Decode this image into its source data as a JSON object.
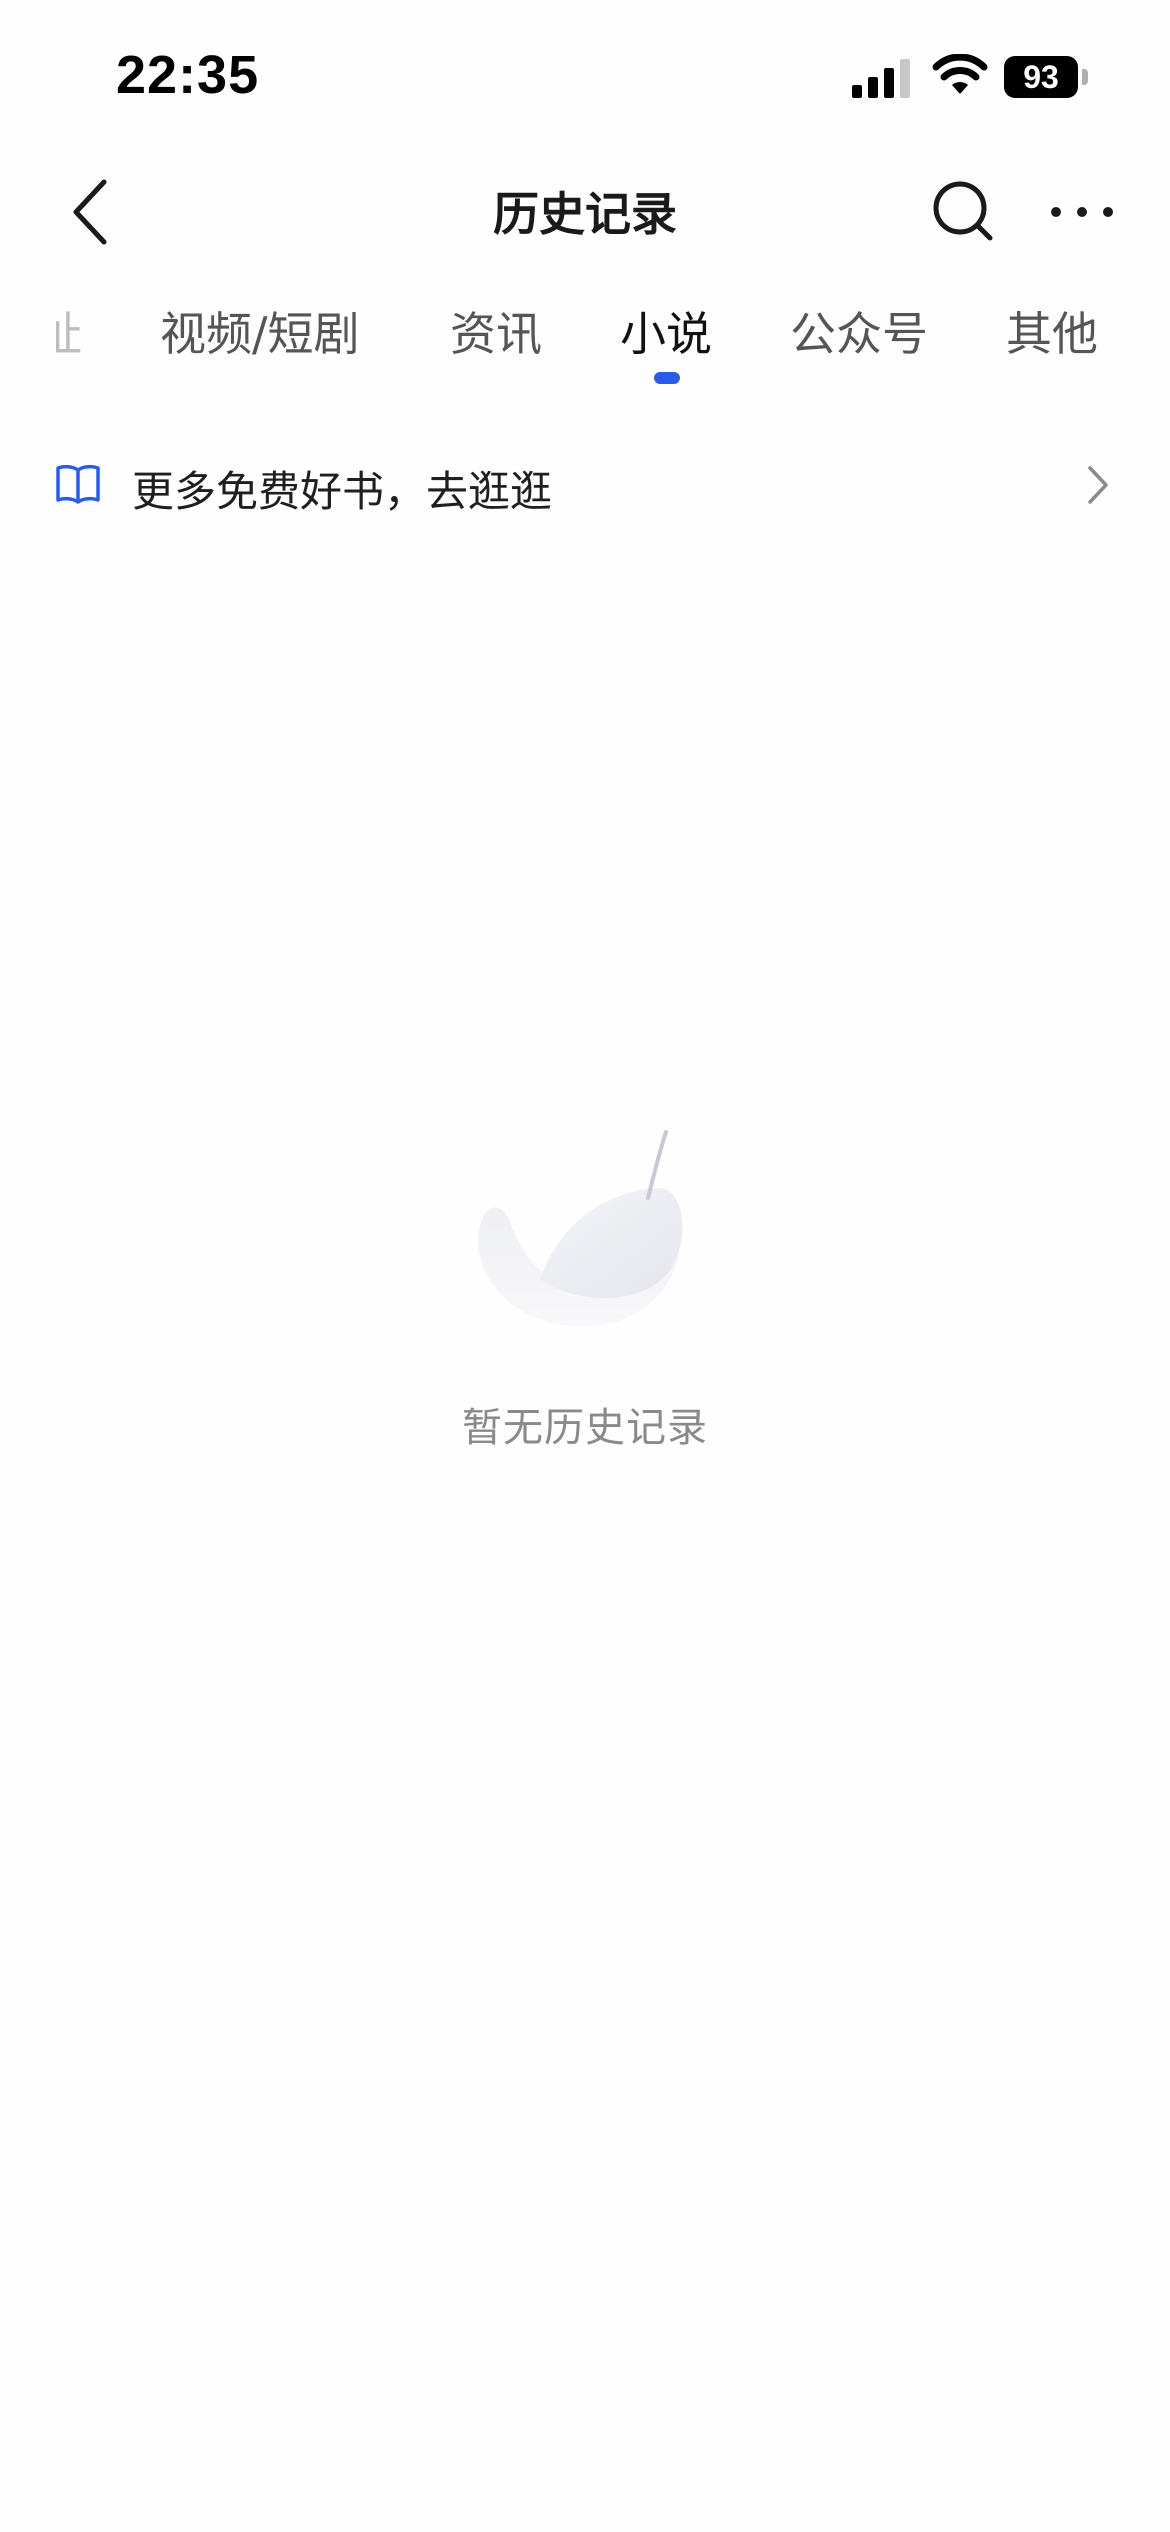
{
  "status_bar": {
    "time": "22:35",
    "battery": "93"
  },
  "nav": {
    "title": "历史记录"
  },
  "tabs": {
    "partial_label": "址",
    "items": [
      {
        "label": "视频/短剧"
      },
      {
        "label": "资讯"
      },
      {
        "label": "小说"
      },
      {
        "label": "公众号"
      },
      {
        "label": "其他"
      }
    ],
    "active_index": 2
  },
  "promo": {
    "label": "更多免费好书，去逛逛"
  },
  "empty_state": {
    "message": "暂无历史记录"
  },
  "colors": {
    "accent": "#2a5ce6",
    "background": "#fefefe",
    "muted_text": "#8a8a8a"
  }
}
